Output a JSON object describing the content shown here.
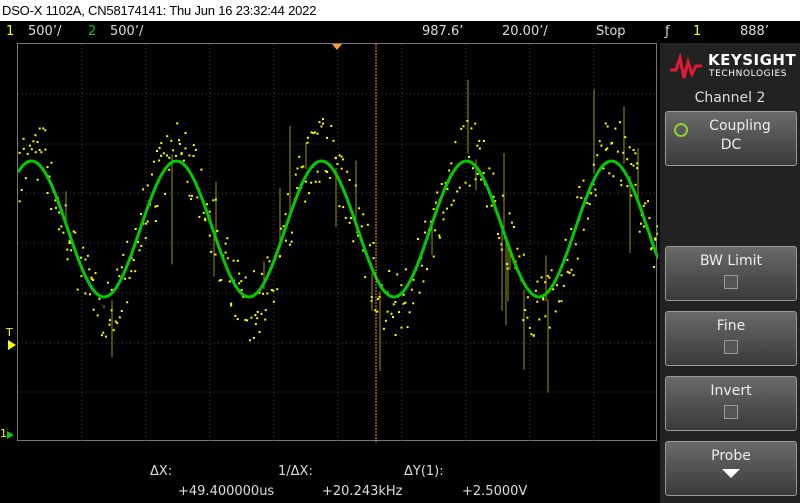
{
  "title": "DSO-X 1102A, CN58174141: Thu Jun 16 23:32:44 2022",
  "status": {
    "ch1_num": "1",
    "ch1_scale": "500’/",
    "ch2_num": "2",
    "ch2_scale": "500’/",
    "time_pos": "987.6’",
    "time_scale": "20.00’/",
    "run_state": "Stop",
    "trig_icon": "ƒ",
    "trig_ch": "1",
    "trig_level": "888’"
  },
  "colors": {
    "ch1": "#ffff00",
    "ch2": "#00cc00",
    "cursor": "#ff9933",
    "grid": "#444444",
    "accent": "#e31937"
  },
  "markers": {
    "trigger_level": "T",
    "ground": "1"
  },
  "side": {
    "brand": "KEYSIGHT",
    "brand_sub": "TECHNOLOGIES",
    "channel_title": "Channel 2",
    "softkeys": [
      {
        "label": "Coupling",
        "value": "DC"
      },
      {
        "label": "BW Limit"
      },
      {
        "label": "Fine"
      },
      {
        "label": "Invert"
      },
      {
        "label": "Probe"
      }
    ]
  },
  "measurements": {
    "dx_label": "ΔX:",
    "dx_value": "+49.400000us",
    "inv_dx_label": "1/ΔX:",
    "inv_dx_value": "+20.243kHz",
    "dy_label": "ΔY(1):",
    "dy_value": "+2.5000V"
  }
}
